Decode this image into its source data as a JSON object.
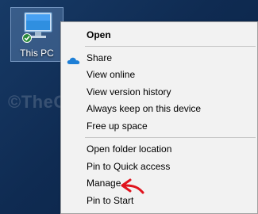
{
  "desktop": {
    "icon_label": "This PC",
    "icon_name": "this-pc-icon"
  },
  "watermark_text": "©TheGeekPage.com",
  "context_menu": {
    "open": "Open",
    "share": "Share",
    "view_online": "View online",
    "view_version_history": "View version history",
    "always_keep": "Always keep on this device",
    "free_up_space": "Free up space",
    "open_folder_location": "Open folder location",
    "pin_quick_access": "Pin to Quick access",
    "manage": "Manage",
    "pin_start": "Pin to Start"
  },
  "colors": {
    "annotation_arrow": "#e0141e",
    "onedrive_cloud": "#1e7fd6",
    "checkmark_badge": "#2a8a3a"
  }
}
